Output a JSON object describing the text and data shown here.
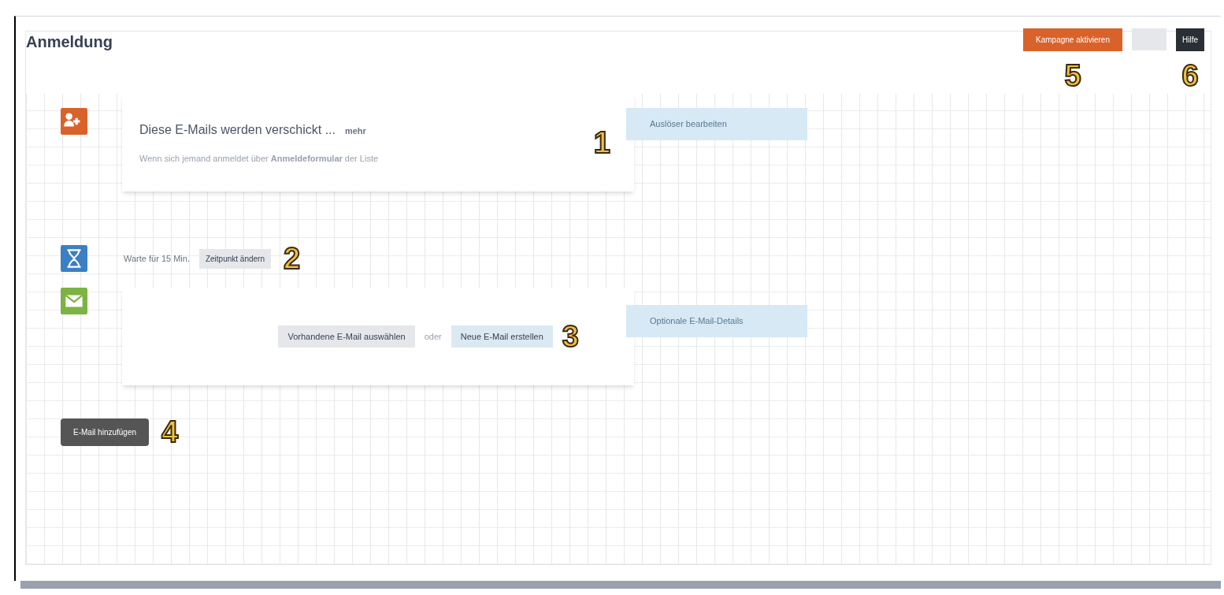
{
  "panel": {
    "title": "Anmeldung"
  },
  "toolbar": [
    {
      "kind": "primary",
      "label": "Kampagne aktivieren",
      "marker": "5"
    },
    {
      "kind": "blank"
    },
    {
      "kind": "dark",
      "label": "Hilfe",
      "marker": "6"
    }
  ],
  "steps": [
    {
      "kind": "trigger",
      "title": "Diese E-Mails werden verschickt ...",
      "title_link": "mehr",
      "subtitle": "Wenn sich jemand anmeldet über **Anmeldeformular** der Liste",
      "marker": "1",
      "side_label": "Auslöser bearbeiten"
    },
    {
      "kind": "wait",
      "text": "Warte für 15 Min.",
      "button": "Zeitpunkt ändern",
      "marker": "2"
    },
    {
      "kind": "email",
      "buttons": [
        "Vorhandene E-Mail auswählen",
        "Neue E-Mail erstellen"
      ],
      "separator": "oder",
      "marker": "3",
      "side_label": "Optionale E-Mail-Details"
    },
    {
      "kind": "add",
      "button": "E-Mail hinzufügen",
      "marker": "4"
    }
  ]
}
